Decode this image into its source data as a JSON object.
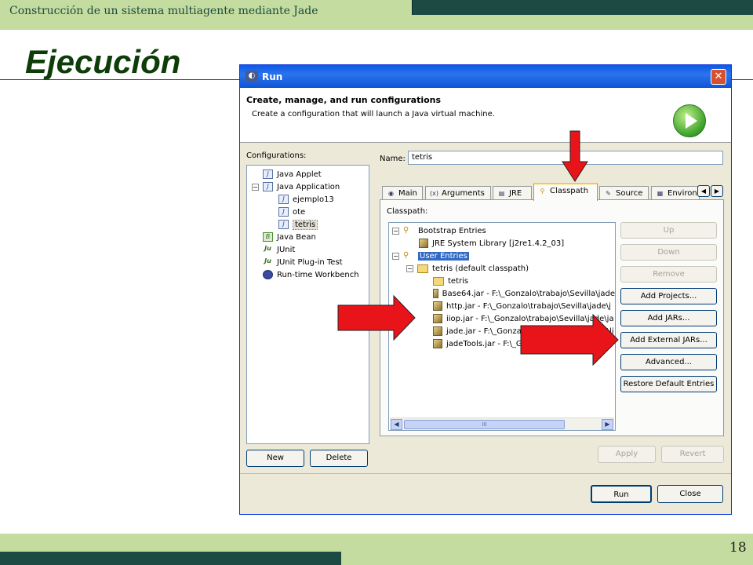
{
  "slide": {
    "header": "Construcción de un sistema multiagente mediante Jade",
    "title": "Ejecución",
    "page_number": "18"
  },
  "dialog": {
    "title": "Run",
    "banner_title": "Create, manage, and run configurations",
    "banner_desc": "Create a configuration that will launch a Java virtual machine.",
    "configurations_label": "Configurations:",
    "configurations": [
      {
        "label": "Java Applet",
        "icon": "java-applet-icon"
      },
      {
        "label": "Java Application",
        "icon": "java-app-icon",
        "expanded": true
      },
      {
        "label": "ejemplo13",
        "icon": "java-config-icon"
      },
      {
        "label": "ote",
        "icon": "java-config-icon"
      },
      {
        "label": "tetris",
        "icon": "java-config-icon",
        "selected": true
      },
      {
        "label": "Java Bean",
        "icon": "java-bean-icon"
      },
      {
        "label": "JUnit",
        "icon": "junit-icon"
      },
      {
        "label": "JUnit Plug-in Test",
        "icon": "junit-plugin-icon"
      },
      {
        "label": "Run-time Workbench",
        "icon": "workbench-icon"
      }
    ],
    "new_button": "New",
    "delete_button": "Delete",
    "name_label": "Name:",
    "name_value": "tetris",
    "tabs": [
      "Main",
      "Arguments",
      "JRE",
      "Classpath",
      "Source",
      "Environ"
    ],
    "active_tab": "Classpath",
    "classpath_label": "Classpath:",
    "classpath_entries": [
      "Bootstrap Entries",
      "JRE System Library [j2re1.4.2_03]",
      "User Entries",
      "tetris (default classpath)",
      "tetris",
      "Base64.jar - F:\\_Gonzalo\\trabajo\\Sevilla\\jade",
      "http.jar - F:\\_Gonzalo\\trabajo\\Sevilla\\jade\\j",
      "iiop.jar - F:\\_Gonzalo\\trabajo\\Sevilla\\jade\\ja",
      "jade.jar - F:\\_Gonzalo\\trabajo\\Sevilla\\jade\\li",
      "jadeTools.jar - F:\\_Gonzalo\\trabajo\\Sevilla\\j"
    ],
    "side_buttons": {
      "up": "Up",
      "down": "Down",
      "remove": "Remove",
      "add_projects": "Add Projects...",
      "add_jars": "Add JARs...",
      "add_external_jars": "Add External JARs...",
      "advanced": "Advanced...",
      "restore": "Restore Default Entries"
    },
    "apply_button": "Apply",
    "revert_button": "Revert",
    "run_button": "Run",
    "close_button": "Close",
    "scroll_thumb": "III"
  },
  "colors": {
    "slide_band": "#c4dca0",
    "slide_dark": "#1e4a44",
    "title_green": "#0f3d0a",
    "arrow_red": "#e8141a",
    "xp_title_blue": "#0a5be4"
  }
}
